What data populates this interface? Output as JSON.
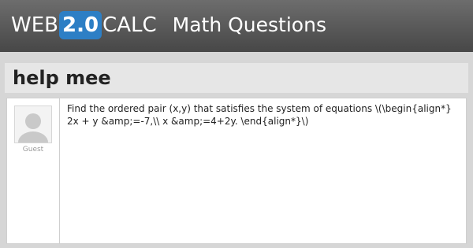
{
  "header": {
    "logo": {
      "prefix": "WEB",
      "version": "2.0",
      "suffix": "CALC"
    },
    "section_title": "Math Questions",
    "colors": {
      "bar": "#5a5a5a",
      "logo_accent": "#2d7fc5"
    }
  },
  "question": {
    "title": "help mee",
    "author": {
      "name": "Guest",
      "avatar_icon": "user-avatar-icon"
    },
    "body": "Find the ordered pair (x,y) that satisfies the system of equations \\(\\begin{align*} 2x + y &amp;=-7,\\\\ x &amp;=4+2y. \\end{align*}\\)"
  }
}
